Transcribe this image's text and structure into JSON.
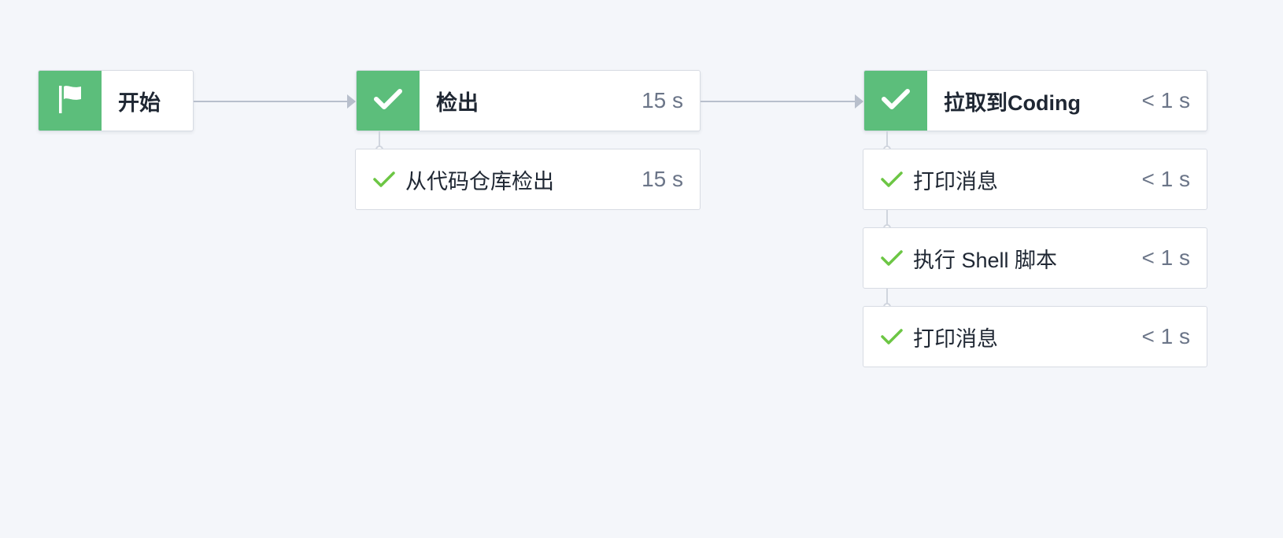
{
  "colors": {
    "success": "#5cbe7b",
    "step_check": "#6cc644",
    "background": "#f4f6fa"
  },
  "icons": {
    "start": "flag-icon",
    "stage_status": "check-icon",
    "step_status": "check-icon"
  },
  "pipeline": {
    "start": {
      "label": "开始"
    },
    "stages": [
      {
        "title": "检出",
        "duration": "15 s",
        "steps": [
          {
            "label": "从代码仓库检出",
            "duration": "15 s"
          }
        ]
      },
      {
        "title": "拉取到Coding",
        "duration": "< 1 s",
        "steps": [
          {
            "label": "打印消息",
            "duration": "< 1 s"
          },
          {
            "label": "执行 Shell 脚本",
            "duration": "< 1 s"
          },
          {
            "label": "打印消息",
            "duration": "< 1 s"
          }
        ]
      }
    ]
  }
}
